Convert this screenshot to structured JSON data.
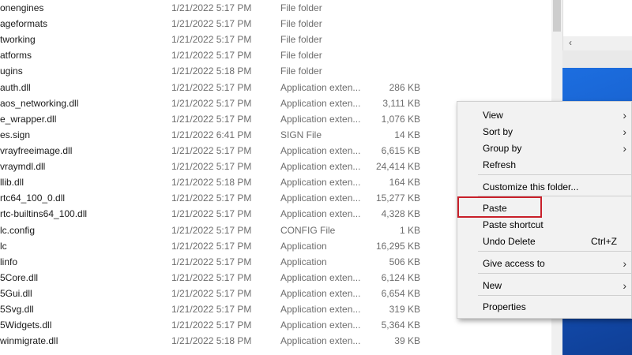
{
  "files": [
    {
      "name": "onengines",
      "date": "1/21/2022 5:17 PM",
      "type": "File folder",
      "size": ""
    },
    {
      "name": "ageformats",
      "date": "1/21/2022 5:17 PM",
      "type": "File folder",
      "size": ""
    },
    {
      "name": "tworking",
      "date": "1/21/2022 5:17 PM",
      "type": "File folder",
      "size": ""
    },
    {
      "name": "atforms",
      "date": "1/21/2022 5:17 PM",
      "type": "File folder",
      "size": ""
    },
    {
      "name": "ugins",
      "date": "1/21/2022 5:18 PM",
      "type": "File folder",
      "size": ""
    },
    {
      "name": "auth.dll",
      "date": "1/21/2022 5:17 PM",
      "type": "Application exten...",
      "size": "286 KB"
    },
    {
      "name": "aos_networking.dll",
      "date": "1/21/2022 5:17 PM",
      "type": "Application exten...",
      "size": "3,111 KB"
    },
    {
      "name": "e_wrapper.dll",
      "date": "1/21/2022 5:17 PM",
      "type": "Application exten...",
      "size": "1,076 KB"
    },
    {
      "name": "es.sign",
      "date": "1/21/2022 6:41 PM",
      "type": "SIGN File",
      "size": "14 KB"
    },
    {
      "name": "vrayfreeimage.dll",
      "date": "1/21/2022 5:17 PM",
      "type": "Application exten...",
      "size": "6,615 KB"
    },
    {
      "name": "vraymdl.dll",
      "date": "1/21/2022 5:17 PM",
      "type": "Application exten...",
      "size": "24,414 KB"
    },
    {
      "name": "llib.dll",
      "date": "1/21/2022 5:18 PM",
      "type": "Application exten...",
      "size": "164 KB"
    },
    {
      "name": "rtc64_100_0.dll",
      "date": "1/21/2022 5:17 PM",
      "type": "Application exten...",
      "size": "15,277 KB"
    },
    {
      "name": "rtc-builtins64_100.dll",
      "date": "1/21/2022 5:17 PM",
      "type": "Application exten...",
      "size": "4,328 KB"
    },
    {
      "name": "lc.config",
      "date": "1/21/2022 5:17 PM",
      "type": "CONFIG File",
      "size": "1 KB"
    },
    {
      "name": "lc",
      "date": "1/21/2022 5:17 PM",
      "type": "Application",
      "size": "16,295 KB"
    },
    {
      "name": "linfo",
      "date": "1/21/2022 5:17 PM",
      "type": "Application",
      "size": "506 KB"
    },
    {
      "name": "5Core.dll",
      "date": "1/21/2022 5:17 PM",
      "type": "Application exten...",
      "size": "6,124 KB"
    },
    {
      "name": "5Gui.dll",
      "date": "1/21/2022 5:17 PM",
      "type": "Application exten...",
      "size": "6,654 KB"
    },
    {
      "name": "5Svg.dll",
      "date": "1/21/2022 5:17 PM",
      "type": "Application exten...",
      "size": "319 KB"
    },
    {
      "name": "5Widgets.dll",
      "date": "1/21/2022 5:17 PM",
      "type": "Application exten...",
      "size": "5,364 KB"
    },
    {
      "name": "winmigrate.dll",
      "date": "1/21/2022 5:18 PM",
      "type": "Application exten...",
      "size": "39 KB"
    }
  ],
  "context_menu": {
    "view": "View",
    "sort_by": "Sort by",
    "group_by": "Group by",
    "refresh": "Refresh",
    "customize": "Customize this folder...",
    "paste": "Paste",
    "paste_shortcut": "Paste shortcut",
    "undo_delete": "Undo Delete",
    "undo_shortcut": "Ctrl+Z",
    "give_access": "Give access to",
    "new": "New",
    "properties": "Properties"
  },
  "colors": {
    "highlight_border": "#c8202a",
    "desktop_blue": "#1f5fbf"
  },
  "icons": {
    "submenu_arrow": "chevron-right-icon",
    "scroll_left": "chevron-left-icon"
  }
}
